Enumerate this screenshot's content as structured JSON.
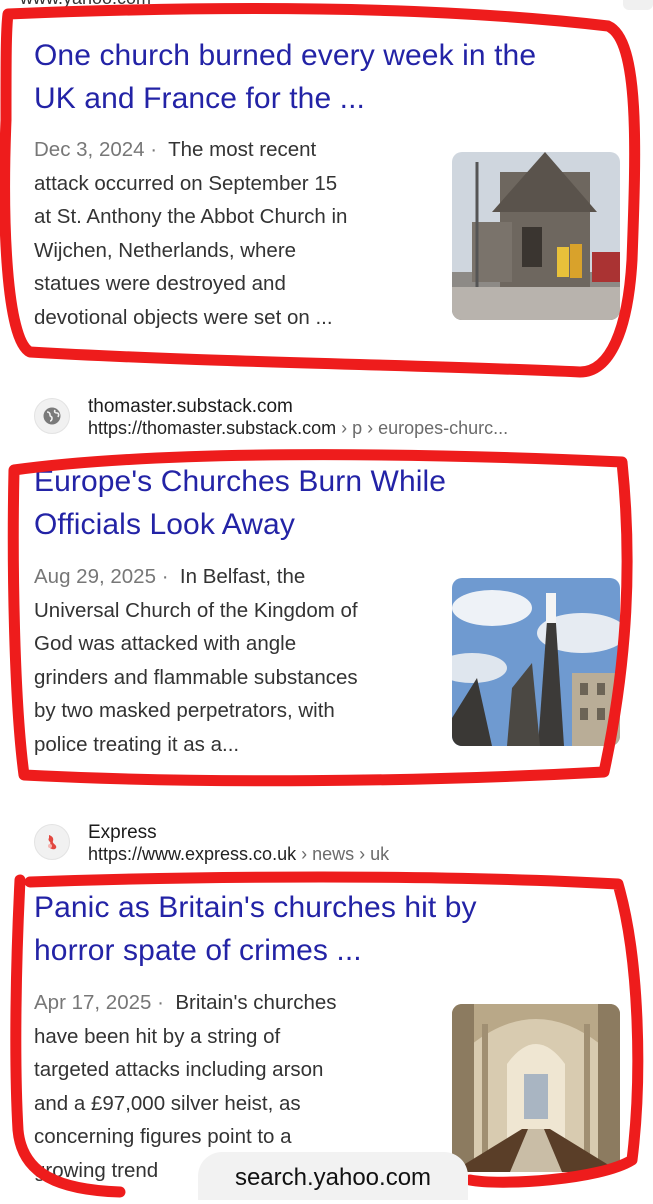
{
  "top_fragment": "www.yahoo.com",
  "results": [
    {
      "title_line1": "One church burned every week in the",
      "title_line2": "UK and France for the ...",
      "date": "Dec 3, 2024",
      "separator": "·",
      "snippet_lines": [
        "The most recent",
        "attack occurred on September 15",
        "at St. Anthony the Abbot Church in",
        "Wijchen, Netherlands, where",
        "statues were destroyed and",
        "devotional objects were set on ..."
      ],
      "thumb_icon": "church-firefighters-image"
    },
    {
      "source_name": "thomaster.substack.com",
      "source_url": "https://thomaster.substack.com",
      "source_crumbs": " › p › europes-churc...",
      "title_line1": "Europe's Churches Burn While",
      "title_line2": "Officials Look Away",
      "date": "Aug 29, 2025",
      "separator": "·",
      "snippet_lines": [
        "In Belfast, the",
        "Universal Church of the Kingdom of",
        "God was attacked with angle",
        "grinders and flammable substances",
        "by two masked perpetrators, with",
        "police treating it as a..."
      ],
      "thumb_icon": "burning-spire-image"
    },
    {
      "source_name": "Express",
      "source_url": "https://www.express.co.uk",
      "source_crumbs": " › news › uk",
      "title_line1": "Panic as Britain's churches hit by",
      "title_line2": "horror spate of crimes ...",
      "date": "Apr 17, 2025",
      "separator": "·",
      "snippet_lines": [
        "Britain's churches",
        "have been hit by a string of",
        "targeted attacks including arson",
        "and a £97,000 silver heist, as",
        "concerning figures point to a",
        "growing trend"
      ],
      "thumb_icon": "cathedral-interior-image"
    }
  ],
  "search_pill": "search.yahoo.com",
  "colors": {
    "title": "#2323a6",
    "marker": "#ee1c1c",
    "snippet": "#333333",
    "date": "#777777"
  }
}
